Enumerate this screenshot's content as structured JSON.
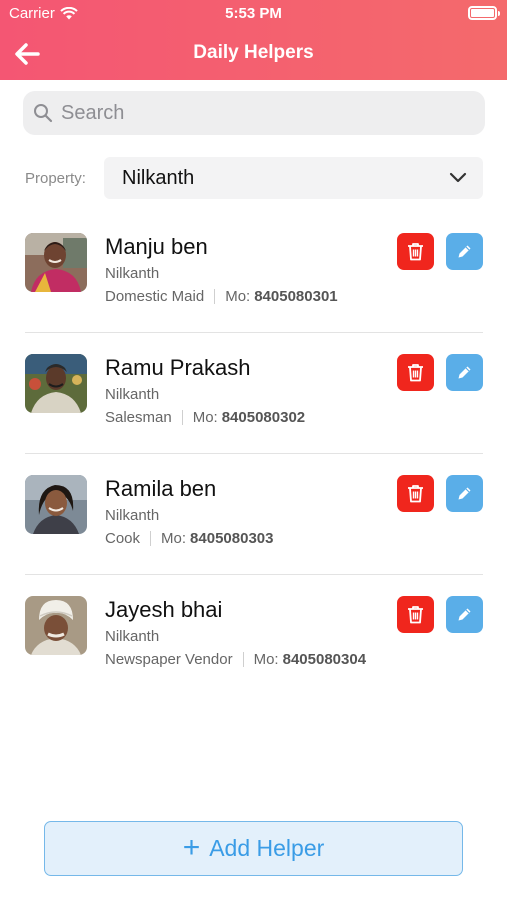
{
  "status_bar": {
    "carrier": "Carrier",
    "time": "5:53 PM"
  },
  "header": {
    "title": "Daily Helpers"
  },
  "search": {
    "placeholder": "Search"
  },
  "property": {
    "label": "Property:",
    "selected": "Nilkanth"
  },
  "helpers": [
    {
      "name": "Manju ben",
      "property": "Nilkanth",
      "role": "Domestic Maid",
      "mo_label": "Mo:",
      "mobile": "8405080301"
    },
    {
      "name": "Ramu Prakash",
      "property": "Nilkanth",
      "role": "Salesman",
      "mo_label": "Mo:",
      "mobile": "8405080302"
    },
    {
      "name": "Ramila ben",
      "property": "Nilkanth",
      "role": "Cook",
      "mo_label": "Mo:",
      "mobile": "8405080303"
    },
    {
      "name": "Jayesh bhai",
      "property": "Nilkanth",
      "role": "Newspaper Vendor",
      "mo_label": "Mo:",
      "mobile": "8405080304"
    }
  ],
  "add_button": {
    "label": "Add Helper"
  },
  "colors": {
    "header_start": "#f45673",
    "header_end": "#f46a6c",
    "delete": "#f0261d",
    "edit": "#5aaee8",
    "add_accent": "#3a9ce6"
  },
  "icons": [
    "wifi-icon",
    "battery-icon",
    "back-arrow-icon",
    "search-icon",
    "chevron-down-icon",
    "trash-icon",
    "pencil-icon",
    "plus-icon"
  ]
}
